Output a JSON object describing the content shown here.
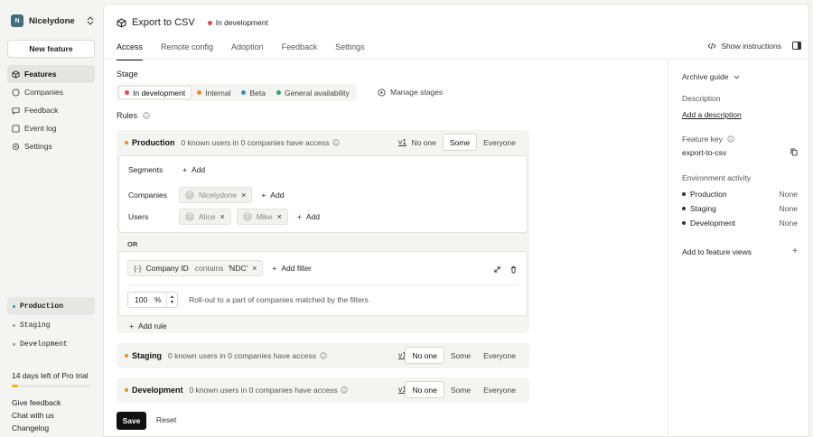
{
  "org": {
    "initial": "N",
    "name": "Nicelydone"
  },
  "sidebar": {
    "new_feature": "New feature",
    "items": [
      {
        "label": "Features",
        "icon": "box-icon"
      },
      {
        "label": "Companies",
        "icon": "building-icon"
      },
      {
        "label": "Feedback",
        "icon": "chat-icon"
      },
      {
        "label": "Event log",
        "icon": "list-icon"
      },
      {
        "label": "Settings",
        "icon": "gear-icon"
      }
    ],
    "environments": [
      "Production",
      "Staging",
      "Development"
    ],
    "trial_text": "14 days left of Pro trial",
    "trial_progress": 0.08,
    "footer_links": [
      "Give feedback",
      "Chat with us",
      "Changelog"
    ]
  },
  "header": {
    "title": "Export to CSV",
    "status": "In development"
  },
  "tabs": [
    "Access",
    "Remote config",
    "Adoption",
    "Feedback",
    "Settings"
  ],
  "show_instructions": "Show instructions",
  "stage": {
    "label": "Stage",
    "options": [
      {
        "label": "In development",
        "color": "#e5484d"
      },
      {
        "label": "Internal",
        "color": "#f08a24"
      },
      {
        "label": "Beta",
        "color": "#3a8fb7"
      },
      {
        "label": "General availability",
        "color": "#30a46c"
      }
    ],
    "manage": "Manage stages"
  },
  "rules_label": "Rules",
  "envcards": [
    {
      "name": "Production",
      "desc": "0 known users in 0 companies have access",
      "version": "v1",
      "mode": "Some"
    },
    {
      "name": "Staging",
      "desc": "0 known users in 0 companies have access",
      "version": "v1",
      "mode": "No one"
    },
    {
      "name": "Development",
      "desc": "0 known users in 0 companies have access",
      "version": "v1",
      "mode": "No one"
    }
  ],
  "modes": [
    "No one",
    "Some",
    "Everyone"
  ],
  "targets": {
    "segments_label": "Segments",
    "companies_label": "Companies",
    "users_label": "Users",
    "add": "Add",
    "companies": [
      {
        "name": "Nicelydone",
        "initial": "?"
      }
    ],
    "users": [
      {
        "name": "Alice",
        "initial": "?"
      },
      {
        "name": "Mike",
        "initial": "?"
      }
    ]
  },
  "or_label": "OR",
  "filter": {
    "field": "Company ID",
    "op": "contains",
    "value": "'NDC'",
    "add_filter": "Add filter"
  },
  "rollout": {
    "value": "100",
    "unit": "%",
    "text": "Roll-out to a part of companies matched by the filters"
  },
  "add_rule": "Add rule",
  "actions": {
    "save": "Save",
    "reset": "Reset"
  },
  "right": {
    "archive": "Archive guide",
    "description_label": "Description",
    "add_description": "Add a description",
    "feature_key_label": "Feature key",
    "feature_key": "export-to-csv",
    "env_activity_label": "Environment activity",
    "env_activity": [
      {
        "name": "Production",
        "value": "None"
      },
      {
        "name": "Staging",
        "value": "None"
      },
      {
        "name": "Development",
        "value": "None"
      }
    ],
    "add_views": "Add to feature views"
  }
}
